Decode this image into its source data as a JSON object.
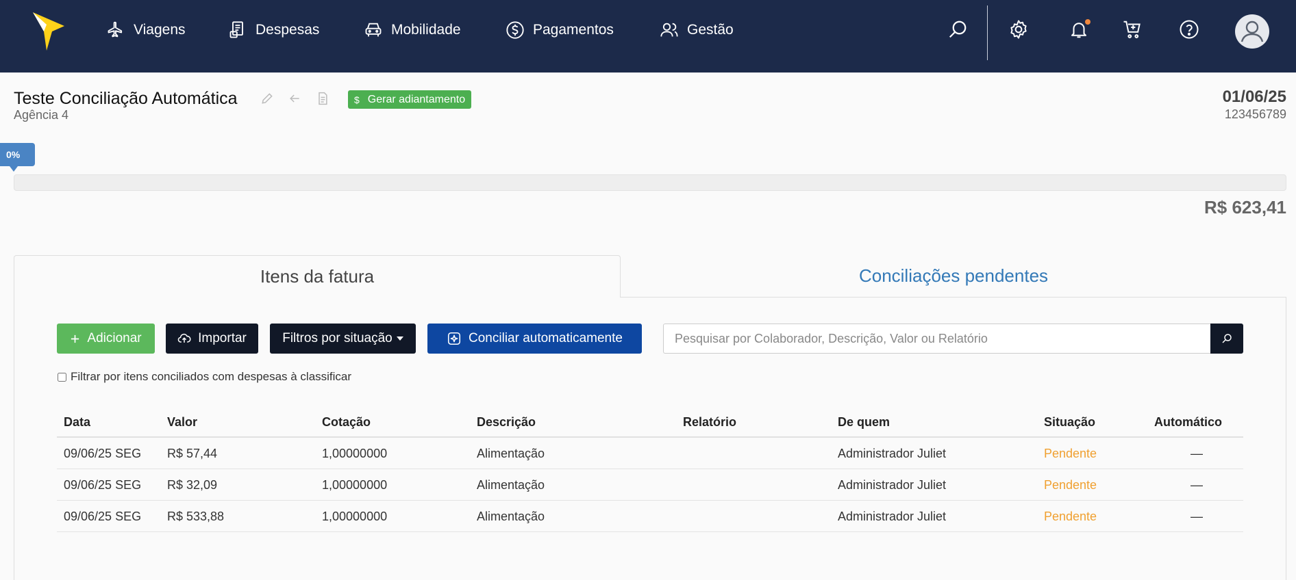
{
  "nav": {
    "items": [
      {
        "label": "Viagens",
        "icon": "airplane-icon"
      },
      {
        "label": "Despesas",
        "icon": "receipt-icon"
      },
      {
        "label": "Mobilidade",
        "icon": "car-icon"
      },
      {
        "label": "Pagamentos",
        "icon": "dollar-circle-icon"
      },
      {
        "label": "Gestão",
        "icon": "users-icon"
      }
    ],
    "right_icons": [
      "search-icon",
      "gear-icon",
      "bell-icon",
      "cart-icon",
      "help-icon",
      "avatar-icon"
    ],
    "background": "#1c2a4a"
  },
  "header": {
    "title": "Teste Conciliação Automática",
    "subtitle": "Agência 4",
    "advance_button": "Gerar adiantamento",
    "advance_icon_glyph": "$",
    "date": "01/06/25",
    "code": "123456789"
  },
  "progress": {
    "label": "0%",
    "value": 0,
    "total": "R$ 623,41"
  },
  "tabs": {
    "active": "Itens da fatura",
    "inactive": "Conciliações pendentes"
  },
  "toolbar": {
    "add": "Adicionar",
    "import": "Importar",
    "filter": "Filtros por situação",
    "auto": "Conciliar automaticamente",
    "search_placeholder": "Pesquisar por Colaborador, Descrição, Valor ou Relatório",
    "checkbox_label": "Filtrar por itens conciliados com despesas à classificar"
  },
  "table": {
    "headers": [
      "Data",
      "Valor",
      "Cotação",
      "Descrição",
      "Relatório",
      "De quem",
      "Situação",
      "Automático"
    ],
    "rows": [
      {
        "data": "09/06/25 SEG",
        "valor": "R$ 57,44",
        "cotacao": "1,00000000",
        "descricao": "Alimentação",
        "relatorio": "",
        "de_quem": "Administrador Juliet",
        "situacao": "Pendente",
        "automatico": "—"
      },
      {
        "data": "09/06/25 SEG",
        "valor": "R$ 32,09",
        "cotacao": "1,00000000",
        "descricao": "Alimentação",
        "relatorio": "",
        "de_quem": "Administrador Juliet",
        "situacao": "Pendente",
        "automatico": "—"
      },
      {
        "data": "09/06/25 SEG",
        "valor": "R$ 533,88",
        "cotacao": "1,00000000",
        "descricao": "Alimentação",
        "relatorio": "",
        "de_quem": "Administrador Juliet",
        "situacao": "Pendente",
        "automatico": "—"
      }
    ]
  },
  "colors": {
    "accent_blue": "#3379b7",
    "pending": "#f0a030",
    "green": "#5cb85c",
    "dark": "#111827",
    "auto_blue": "#0e47a1"
  }
}
